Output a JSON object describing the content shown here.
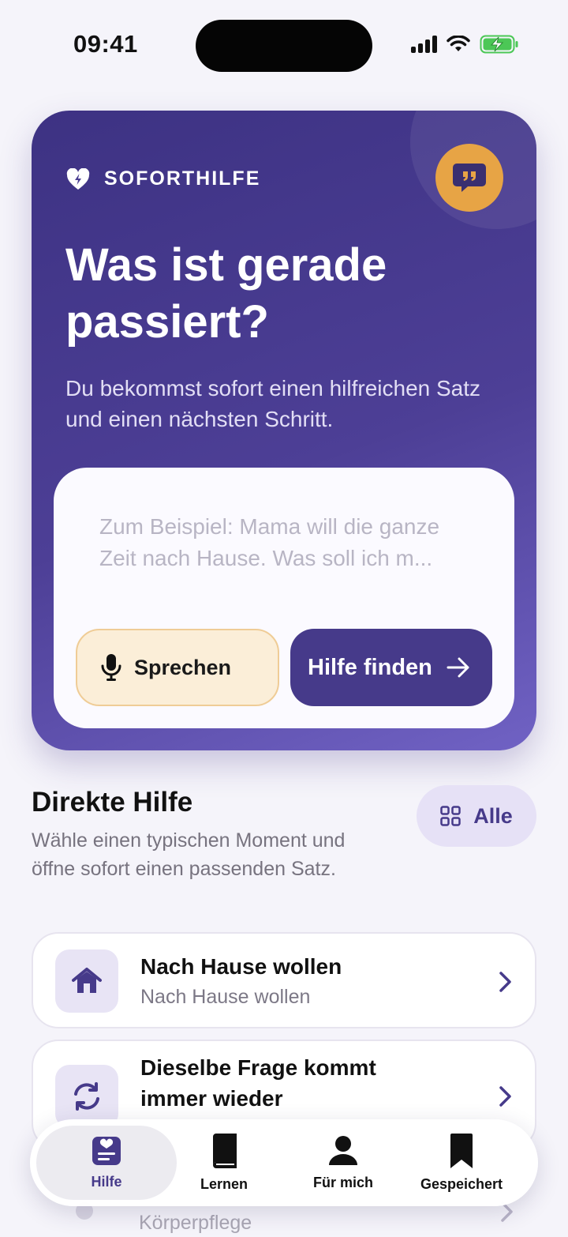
{
  "status_bar": {
    "time": "09:41"
  },
  "hero": {
    "kicker": "SOFORTHILFE",
    "title": "Was ist gerade passiert?",
    "subtitle": "Du bekommst sofort einen hilfreichen Satz und einen nächsten Schritt.",
    "input_placeholder": "Zum Beispiel: Mama will die ganze Zeit nach Hause. Was soll ich m...",
    "speak_label": "Sprechen",
    "find_label": "Hilfe finden"
  },
  "direct_help": {
    "title": "Direkte Hilfe",
    "description": "Wähle einen typischen Moment und öffne sofort einen passenden Satz.",
    "all_label": "Alle",
    "items": [
      {
        "title": "Nach Hause wollen",
        "subtitle": "Nach Hause wollen",
        "icon": "home-icon"
      },
      {
        "title": "Dieselbe Frage kommt immer wieder",
        "subtitle": "",
        "icon": "refresh-icon"
      },
      {
        "title": "",
        "subtitle": "Körperpflege",
        "icon": ""
      }
    ]
  },
  "tabbar": {
    "tabs": [
      {
        "label": "Hilfe",
        "icon": "help-card-icon",
        "active": true
      },
      {
        "label": "Lernen",
        "icon": "book-icon",
        "active": false
      },
      {
        "label": "Für mich",
        "icon": "person-icon",
        "active": false
      },
      {
        "label": "Gespeichert",
        "icon": "bookmark-icon",
        "active": false
      }
    ]
  },
  "colors": {
    "primary": "#463a8a",
    "accent": "#e7a445",
    "background": "#f5f4fa",
    "speak_button": "#fbeed8"
  }
}
